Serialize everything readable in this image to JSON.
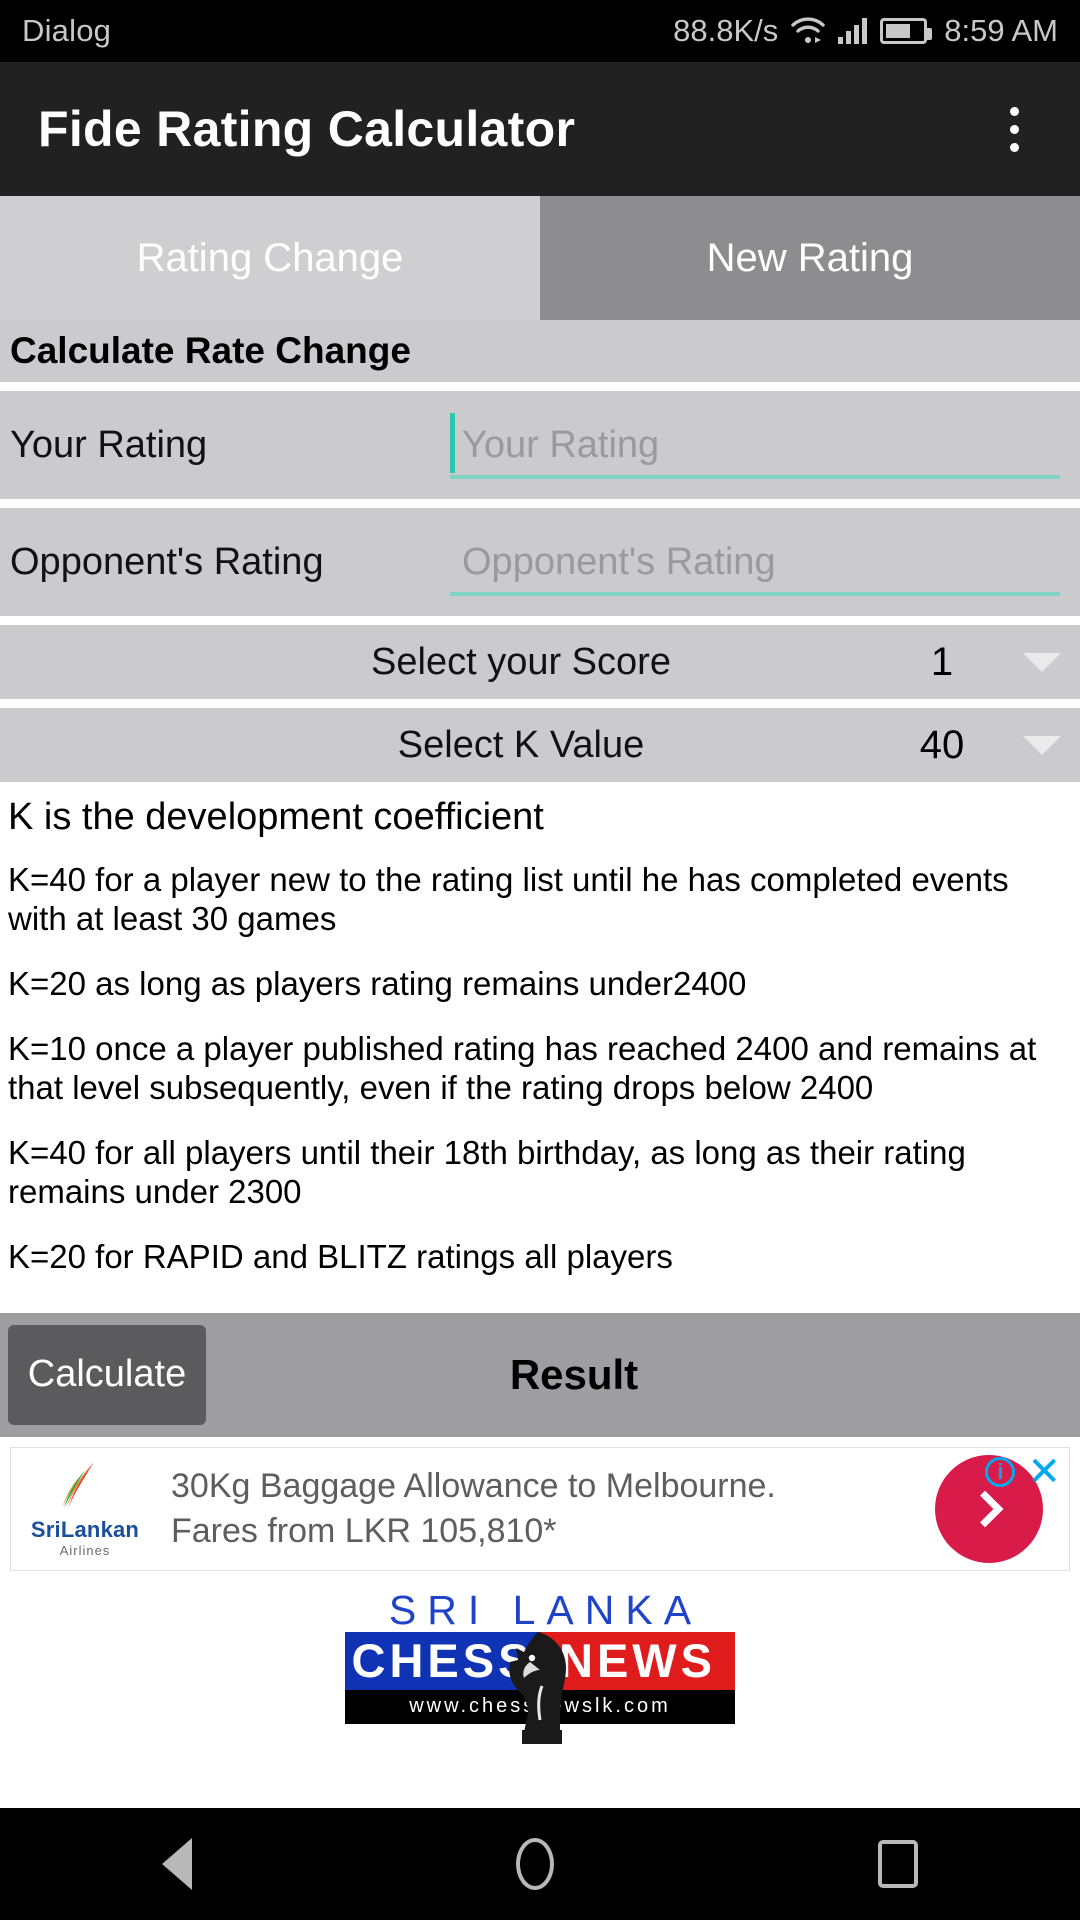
{
  "status_bar": {
    "carrier": "Dialog",
    "network_speed": "88.8K/s",
    "time": "8:59 AM",
    "icons": [
      "wifi-icon",
      "signal-bars-icon",
      "battery-icon"
    ]
  },
  "app_bar": {
    "title": "Fide Rating Calculator",
    "overflow_icon": "more-vertical-icon"
  },
  "tabs": [
    {
      "label": "Rating Change",
      "selected": true
    },
    {
      "label": "New Rating",
      "selected": false
    }
  ],
  "form": {
    "section_title": "Calculate Rate Change",
    "fields": [
      {
        "label": "Your Rating",
        "placeholder": "Your Rating",
        "value": "",
        "focused": true
      },
      {
        "label": "Opponent's Rating",
        "placeholder": "Opponent's Rating",
        "value": "",
        "focused": false
      }
    ],
    "spinners": [
      {
        "label": "Select your Score",
        "value": "1",
        "arrow_icon": "chevron-down-icon"
      },
      {
        "label": "Select K Value",
        "value": "40",
        "arrow_icon": "chevron-down-icon"
      }
    ]
  },
  "k_info": {
    "heading": "K is the development coefficient",
    "paragraphs": [
      "K=40 for a player new to the rating list until he has completed events with at least 30 games",
      "K=20 as long as players rating remains under2400",
      "K=10 once a player published rating has reached 2400 and remains at that level subsequently, even if the rating drops below 2400",
      "K=40 for all players until their 18th birthday, as long as their rating remains under 2300",
      "K=20 for RAPID and BLITZ ratings all players"
    ]
  },
  "action_bar": {
    "calculate_label": "Calculate",
    "result_label": "Result"
  },
  "ad": {
    "brand": "SriLankan",
    "brand_sub": "Airlines",
    "line1": "30Kg Baggage Allowance to Melbourne.",
    "line2": "Fares from LKR 105,810*",
    "cta_icon": "chevron-right-icon",
    "info_badge": "i",
    "close_badge": "✕",
    "accent_color": "#d81b48",
    "badge_color": "#00aaf0"
  },
  "footer_logo": {
    "top_text": "SRI LANKA",
    "left_word": "CHESS",
    "right_word": "NEWS",
    "url": "www.chessnewslk.com",
    "blue": "#1033b5",
    "red": "#e01b1b"
  },
  "nav_bar": {
    "back_icon": "back-triangle-icon",
    "home_icon": "home-circle-icon",
    "recents_icon": "recents-square-icon"
  }
}
